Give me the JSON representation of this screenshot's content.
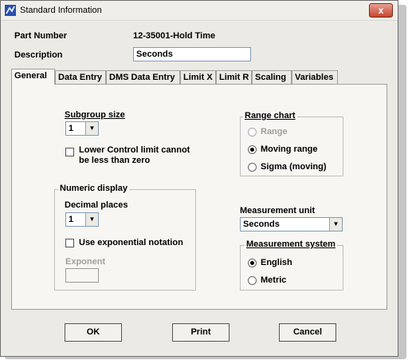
{
  "window": {
    "title": "Standard Information",
    "close_label": "x"
  },
  "part": {
    "label": "Part Number",
    "value": "12-35001-Hold Time"
  },
  "description": {
    "label": "Description",
    "value": "Seconds"
  },
  "tabs": [
    {
      "label": "General"
    },
    {
      "label": "Data Entry"
    },
    {
      "label": "DMS Data Entry"
    },
    {
      "label": "Limit X"
    },
    {
      "label": "Limit R"
    },
    {
      "label": "Scaling"
    },
    {
      "label": "Variables"
    }
  ],
  "general": {
    "subgroup": {
      "label": "Subgroup size",
      "value": "1"
    },
    "lower_control": {
      "line1": "Lower Control limit cannot",
      "line2": "be less than zero",
      "checked": false
    },
    "numeric_display": {
      "legend": "Numeric display",
      "decimal_label": "Decimal places",
      "decimal_value": "1",
      "exponential_label": "Use exponential notation",
      "exponential_checked": false,
      "exponent_label": "Exponent",
      "exponent_value": ""
    },
    "range_chart": {
      "legend": "Range chart",
      "options": [
        {
          "label": "Range",
          "selected": false,
          "disabled": true
        },
        {
          "label": "Moving range",
          "selected": true,
          "disabled": false
        },
        {
          "label": "Sigma (moving)",
          "selected": false,
          "disabled": false
        }
      ]
    },
    "measurement_unit": {
      "label": "Measurement unit",
      "value": "Seconds"
    },
    "measurement_system": {
      "legend": "Measurement system",
      "options": [
        {
          "label": "English",
          "selected": true
        },
        {
          "label": "Metric",
          "selected": false
        }
      ]
    }
  },
  "buttons": {
    "ok": "OK",
    "print": "Print",
    "cancel": "Cancel"
  },
  "colors": {
    "close_button": "#c7452f",
    "window_bg": "#eceae4",
    "panel_bg": "#f7f6f2"
  }
}
